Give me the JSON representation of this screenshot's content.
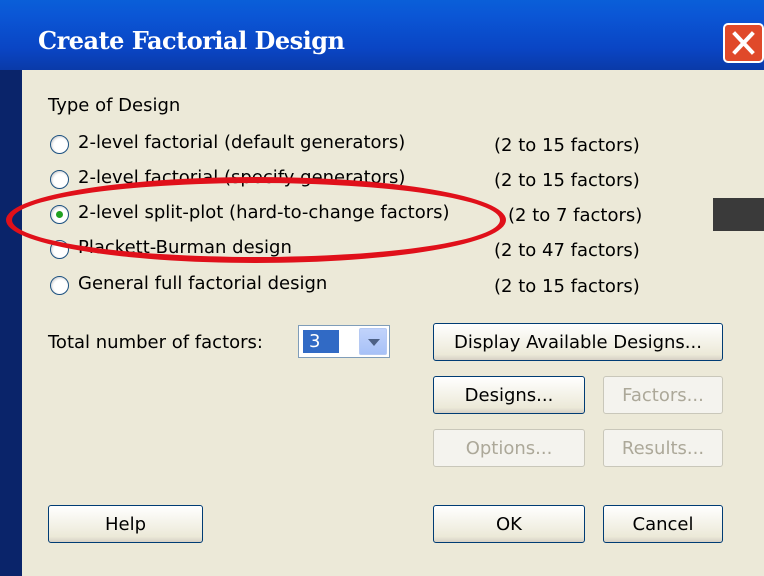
{
  "window": {
    "title": "Create Factorial Design"
  },
  "type_of_design": {
    "heading": "Type of Design",
    "options": [
      {
        "label": "2-level factorial (default generators)",
        "range": "(2 to 15 factors)",
        "selected": false
      },
      {
        "label": "2-level factorial (specify generators)",
        "range": "(2 to 15 factors)",
        "selected": false
      },
      {
        "label": "2-level split-plot (hard-to-change factors)",
        "range": "(2 to 7 factors)",
        "selected": true
      },
      {
        "label": "Plackett-Burman design",
        "range": "(2 to 47 factors)",
        "selected": false
      },
      {
        "label": "General full factorial design",
        "range": "(2 to 15 factors)",
        "selected": false
      }
    ]
  },
  "factors": {
    "label": "Total number of factors:",
    "value": "3"
  },
  "buttons": {
    "display_designs": "Display Available Designs...",
    "designs": "Designs...",
    "factors": "Factors...",
    "options": "Options...",
    "results": "Results...",
    "help": "Help",
    "ok": "OK",
    "cancel": "Cancel"
  },
  "colors": {
    "title_bar": "#0a4fd0",
    "dialog_face": "#ece9d8",
    "highlight_oval": "#e0101a",
    "selected_radio": "#21a121"
  }
}
